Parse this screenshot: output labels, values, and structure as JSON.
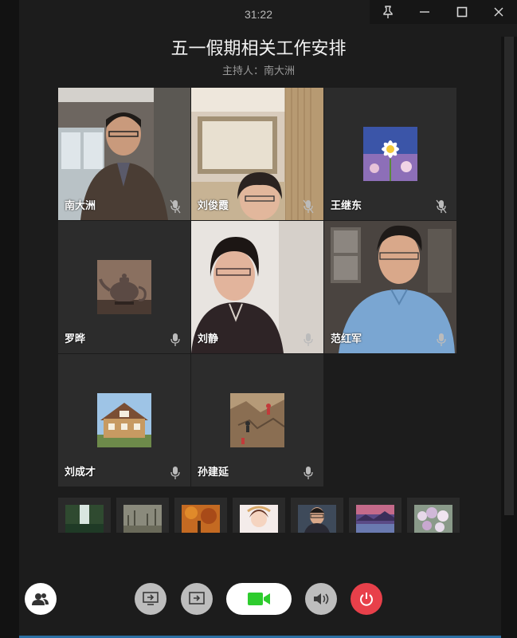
{
  "window": {
    "timer": "31:22",
    "controls": [
      "pin",
      "minimize",
      "maximize",
      "close"
    ]
  },
  "meeting": {
    "title": "五一假期相关工作安排",
    "host_label": "主持人：",
    "host_name": "南大洲"
  },
  "participants": [
    {
      "name": "南大洲",
      "view": "camera"
    },
    {
      "name": "刘俊霞",
      "view": "camera"
    },
    {
      "name": "王继东",
      "view": "avatar",
      "avatar": "flower"
    },
    {
      "name": "罗晔",
      "view": "avatar",
      "avatar": "teapot"
    },
    {
      "name": "刘静",
      "view": "camera"
    },
    {
      "name": "范红军",
      "view": "camera"
    },
    {
      "name": "刘成才",
      "view": "avatar",
      "avatar": "house"
    },
    {
      "name": "孙建延",
      "view": "avatar",
      "avatar": "climbing"
    }
  ],
  "thumbnails": [
    "waterfall",
    "foggy-trees",
    "autumn-leaves",
    "cartoon-girl",
    "man-portrait",
    "sunset-lake",
    "flowers"
  ],
  "toolbar": {
    "participants_icon": "people-icon",
    "share_screen_icon": "screen-share-icon",
    "share_file_icon": "file-share-icon",
    "camera_icon": "video-camera-icon",
    "speaker_icon": "speaker-icon",
    "end_call_icon": "power-icon"
  },
  "colors": {
    "background": "#1c1c1c",
    "tile": "#2c2c2c",
    "camera_active": "#2ecc2e",
    "end_call": "#e8404a"
  }
}
